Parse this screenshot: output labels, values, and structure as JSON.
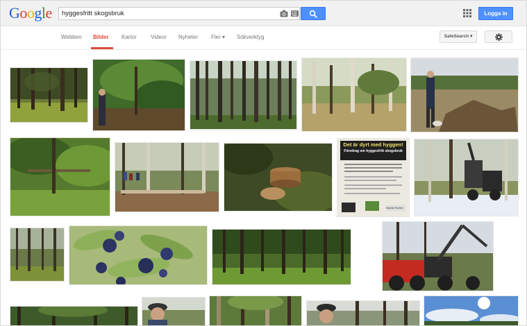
{
  "header": {
    "logo": [
      "G",
      "o",
      "o",
      "g",
      "l",
      "e"
    ],
    "logo_colors": [
      "#1a5fd6",
      "#dc3b2b",
      "#e8b30f",
      "#1a5fd6",
      "#2c9c3c",
      "#dc3b2b"
    ],
    "search_value": "hyggesfritt skogsbruk",
    "login_label": "Logga in"
  },
  "nav": {
    "tabs": [
      "Webben",
      "Bilder",
      "Kartor",
      "Videor",
      "Nyheter",
      "Fler ▾",
      "Sökverktyg"
    ],
    "active_tab": "Bilder",
    "safesearch_label": "SafeSearch ▾"
  },
  "poster": {
    "title_line1": "Det är dyrt med hyggen!",
    "title_line2": "Föredrag om hyggesfritt skogsbruk",
    "footer": "Nordic Forest"
  },
  "colors": {
    "accent_blue": "#4d90fe",
    "active_red": "#dd4b39"
  }
}
